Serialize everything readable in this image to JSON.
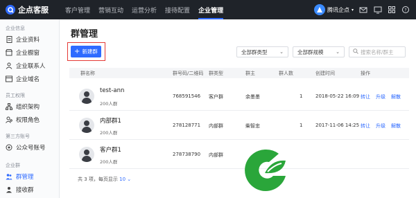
{
  "app": {
    "name": "企点客服"
  },
  "nav": [
    "客户管理",
    "营销互动",
    "运营分析",
    "接待配置",
    "企业管理"
  ],
  "account": {
    "name": "腾讯企点"
  },
  "sidebar": {
    "groups": [
      "企业信息",
      "员工权限",
      "第三方账号",
      "企业群"
    ],
    "items": [
      "企业资料",
      "企业橱窗",
      "企业联系人",
      "企业域名",
      "组织架构",
      "权限角色",
      "公众号账号",
      "群管理",
      "接收群"
    ]
  },
  "page": {
    "title": "群管理"
  },
  "toolbar": {
    "new_label": "新建群",
    "type_select": "全部群类型",
    "size_select": "全部群规模",
    "search_placeholder": "搜索名称/群主"
  },
  "table": {
    "headers": [
      "群名称",
      "群号码/二维码",
      "群类型",
      "群主",
      "群人数",
      "创建时间",
      "操作"
    ],
    "rows": [
      {
        "name": "test-ann",
        "members": "200人群",
        "number": "768591546",
        "type": "客户群",
        "owner": "余墨墨",
        "count": "1",
        "created": "2018-05-22 16:09",
        "ops": [
          "转让",
          "升级",
          "解散"
        ]
      },
      {
        "name": "内部群1",
        "members": "200人群",
        "number": "278128771",
        "type": "内部群",
        "owner": "柴智忠",
        "count": "1",
        "created": "2017-11-06 14:25",
        "ops": [
          "转让",
          "升级",
          "解散"
        ]
      },
      {
        "name": "客户群1",
        "members": "200人群",
        "number": "278738790",
        "type": "内部群",
        "owner": "",
        "count": "",
        "created": "",
        "ops": []
      }
    ]
  },
  "pager": {
    "total_text": "共 3 项，每页显示",
    "page_size": "10"
  },
  "colors": {
    "accent": "#2f6bff",
    "topbar": "#1f2329",
    "highlight_box": "#e53935",
    "watermark": "#2aa63a"
  }
}
